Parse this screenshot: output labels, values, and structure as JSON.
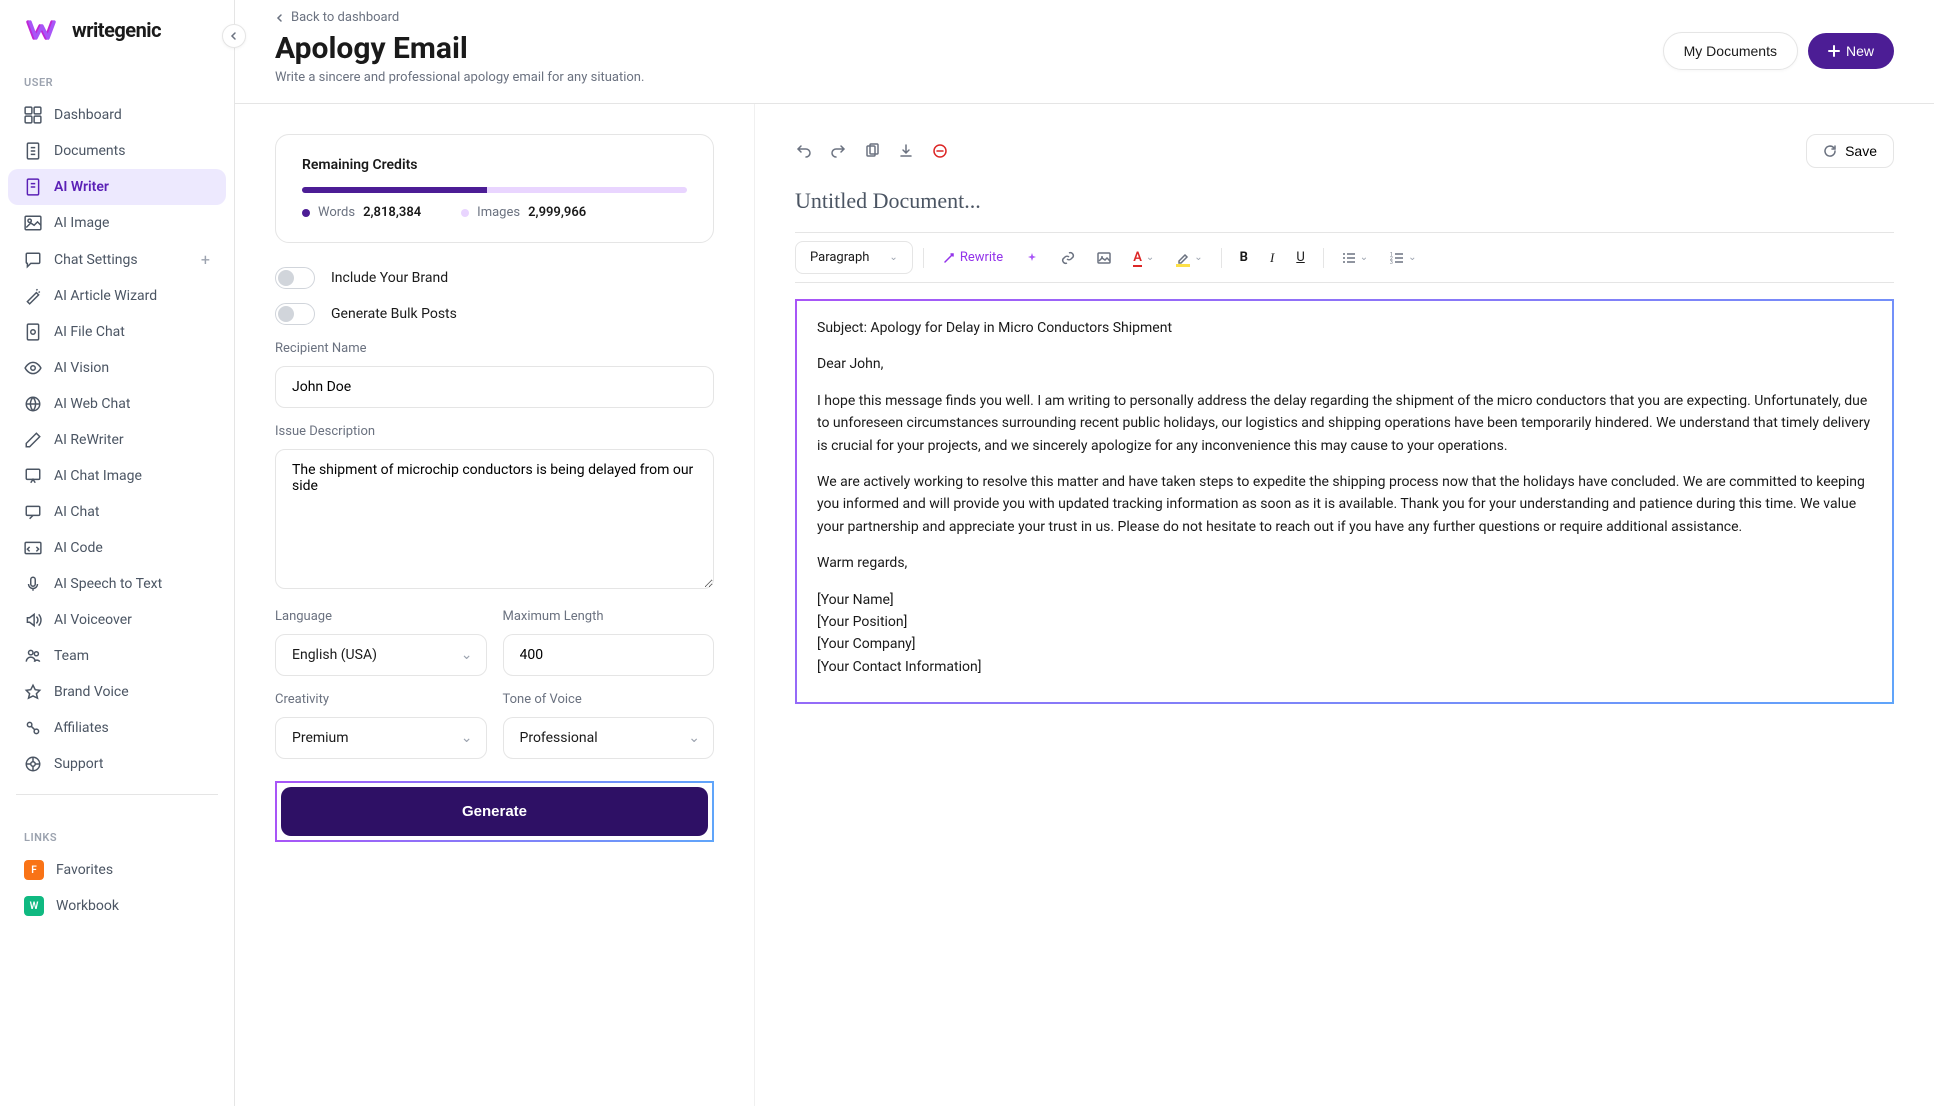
{
  "logo": {
    "text": "writegenic"
  },
  "sidebar": {
    "userLabel": "USER",
    "linksLabel": "LINKS",
    "items": [
      {
        "label": "Dashboard",
        "icon": "grid"
      },
      {
        "label": "Documents",
        "icon": "doc"
      },
      {
        "label": "AI Writer",
        "icon": "file",
        "active": true
      },
      {
        "label": "AI Image",
        "icon": "image"
      },
      {
        "label": "Chat Settings",
        "icon": "chat",
        "plus": true
      },
      {
        "label": "AI Article Wizard",
        "icon": "wand"
      },
      {
        "label": "AI File Chat",
        "icon": "filechat"
      },
      {
        "label": "AI Vision",
        "icon": "eye"
      },
      {
        "label": "AI Web Chat",
        "icon": "web"
      },
      {
        "label": "AI ReWriter",
        "icon": "pen"
      },
      {
        "label": "AI Chat Image",
        "icon": "chatimg"
      },
      {
        "label": "AI Chat",
        "icon": "chat2"
      },
      {
        "label": "AI Code",
        "icon": "code"
      },
      {
        "label": "AI Speech to Text",
        "icon": "mic"
      },
      {
        "label": "AI Voiceover",
        "icon": "speaker"
      },
      {
        "label": "Team",
        "icon": "team"
      },
      {
        "label": "Brand Voice",
        "icon": "brand"
      },
      {
        "label": "Affiliates",
        "icon": "affiliate"
      },
      {
        "label": "Support",
        "icon": "support"
      }
    ],
    "links": [
      {
        "label": "Favorites",
        "badge": "F",
        "color": "f"
      },
      {
        "label": "Workbook",
        "badge": "W",
        "color": "w"
      }
    ]
  },
  "header": {
    "back": "Back to dashboard",
    "title": "Apology Email",
    "subtitle": "Write a sincere and professional apology email for any situation.",
    "myDocs": "My Documents",
    "new": "New"
  },
  "credits": {
    "title": "Remaining Credits",
    "wordsLabel": "Words",
    "wordsValue": "2,818,384",
    "imagesLabel": "Images",
    "imagesValue": "2,999,966",
    "percent": 48
  },
  "form": {
    "includeBrand": "Include Your Brand",
    "bulkPosts": "Generate Bulk Posts",
    "recipientLabel": "Recipient Name",
    "recipientValue": "John Doe",
    "issueLabel": "Issue Description",
    "issueValue": "The shipment of microchip conductors is being delayed from our side",
    "languageLabel": "Language",
    "languageValue": "English (USA)",
    "maxLengthLabel": "Maximum Length",
    "maxLengthValue": "400",
    "creativityLabel": "Creativity",
    "creativityValue": "Premium",
    "toneLabel": "Tone of Voice",
    "toneValue": "Professional",
    "generate": "Generate"
  },
  "editor": {
    "save": "Save",
    "docTitle": "Untitled Document...",
    "paragraph": "Paragraph",
    "rewrite": "Rewrite",
    "subject": "Subject: Apology for Delay in Micro Conductors Shipment",
    "greeting": "Dear John,",
    "body1": "I hope this message finds you well. I am writing to personally address the delay regarding the shipment of the micro conductors that you are expecting. Unfortunately, due to unforeseen circumstances surrounding recent public holidays, our logistics and shipping operations have been temporarily hindered. We understand that timely delivery is crucial for your projects, and we sincerely apologize for any inconvenience this may cause to your operations.",
    "body2": "We are actively working to resolve this matter and have taken steps to expedite the shipping process now that the holidays have concluded. We are committed to keeping you informed and will provide you with updated tracking information as soon as it is available. Thank you for your understanding and patience during this time. We value your partnership and appreciate your trust in us. Please do not hesitate to reach out if you have any further questions or require additional assistance.",
    "closing": "Warm regards,",
    "sig1": "[Your Name]",
    "sig2": "[Your Position]",
    "sig3": "[Your Company]",
    "sig4": "[Your Contact Information]"
  }
}
